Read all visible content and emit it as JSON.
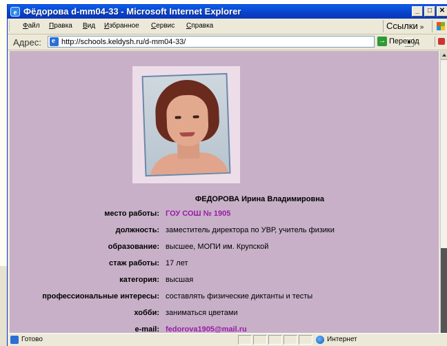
{
  "window": {
    "title": "Фёдорова d-mm04-33 - Microsoft Internet Explorer",
    "buttons": [
      "_",
      "□",
      "✕"
    ]
  },
  "menu": [
    "Файл",
    "Правка",
    "Вид",
    "Избранное",
    "Сервис",
    "Справка"
  ],
  "links_label": "Ссылки",
  "links_chevron": "»",
  "address": {
    "label": "Адрес:",
    "url": "http://schools.keldysh.ru/d-mm04-33/",
    "go_label": "Переход"
  },
  "profile": {
    "name": "ФЕДОРОВА Ирина Владимировна",
    "rows": [
      {
        "label": "место работы:",
        "value": "ГОУ СОШ № 1905",
        "link": true
      },
      {
        "label": "должность:",
        "value": "заместитель директора по УВР, учитель физики",
        "link": false
      },
      {
        "label": "образование:",
        "value": "высшее, МОПИ им. Крупской",
        "link": false
      },
      {
        "label": "стаж работы:",
        "value": "17 лет",
        "link": false
      },
      {
        "label": "категория:",
        "value": "высшая",
        "link": false
      },
      {
        "label": "профессиональные интересы:",
        "value": "составлять физические диктанты и тесты",
        "link": false
      },
      {
        "label": "хобби:",
        "value": "заниматься цветами",
        "link": false
      },
      {
        "label": "e-mail:",
        "value": "fedorova1905@mail.ru",
        "link": true
      }
    ]
  },
  "status": {
    "text": "Готово",
    "zone": "Интернет"
  },
  "colors": {
    "content_bg": "#c7b0c8",
    "link": "#9c1aa6",
    "titlebar": "#0a40c8"
  }
}
